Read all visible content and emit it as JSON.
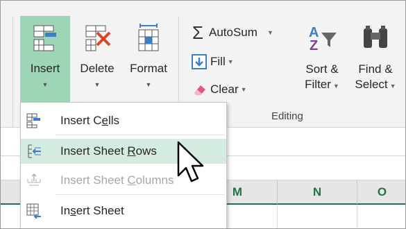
{
  "ribbon": {
    "insert": {
      "label": "Insert"
    },
    "delete": {
      "label": "Delete"
    },
    "format": {
      "label": "Format"
    },
    "autosum": {
      "label": "AutoSum"
    },
    "fill": {
      "label": "Fill"
    },
    "clear": {
      "label": "Clear"
    },
    "sort_filter": {
      "line1": "Sort &",
      "line2": "Filter"
    },
    "find_select": {
      "line1": "Find &",
      "line2": "Select"
    },
    "editing_group": "Editing"
  },
  "menu": {
    "items": [
      {
        "pre": "Insert C",
        "accel": "e",
        "post": "lls",
        "enabled": true,
        "highlighted": false
      },
      {
        "pre": "Insert Sheet ",
        "accel": "R",
        "post": "ows",
        "enabled": true,
        "highlighted": true
      },
      {
        "pre": "Insert Sheet ",
        "accel": "C",
        "post": "olumns",
        "enabled": false,
        "highlighted": false
      },
      {
        "pre": "In",
        "accel": "s",
        "post": "ert Sheet",
        "enabled": true,
        "highlighted": false
      }
    ]
  },
  "columns": [
    "M",
    "N",
    "O"
  ],
  "colors": {
    "accent": "#217346",
    "hover": "#d4ecdf",
    "selected_button": "#9fd5b7"
  }
}
